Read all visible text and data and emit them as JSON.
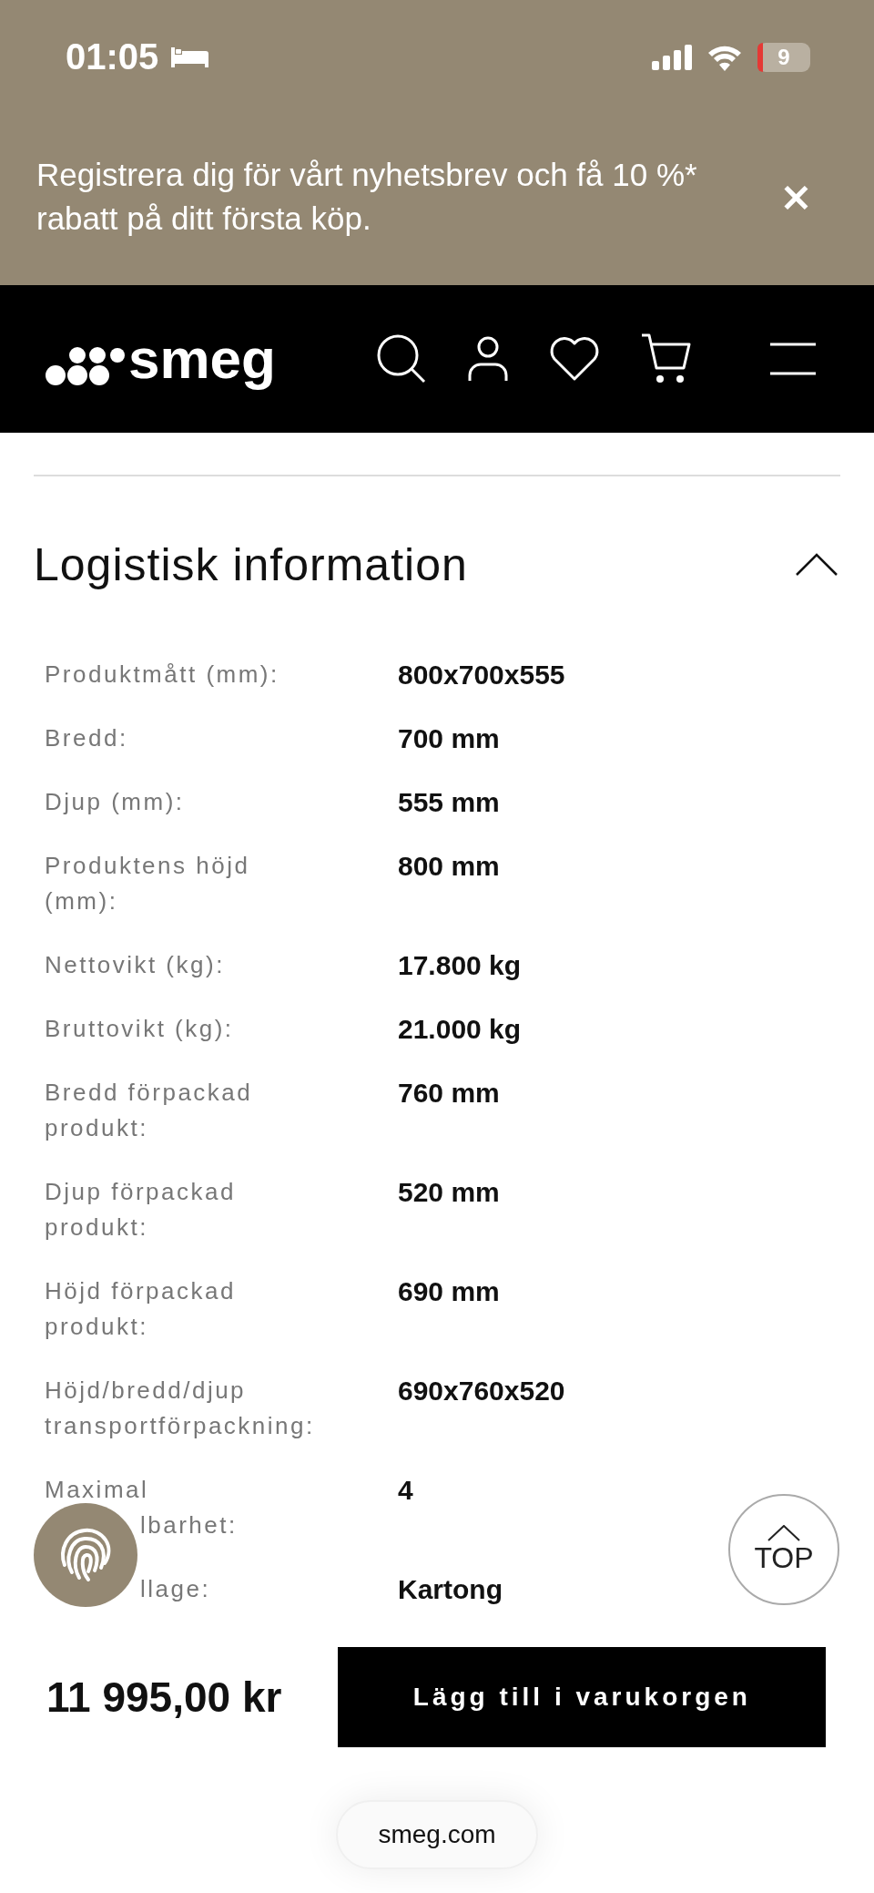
{
  "status_bar": {
    "time": "01:05",
    "battery": "9"
  },
  "banner": {
    "text": "Registrera dig för vårt nyhetsbrev och få 10 %* rabatt på ditt första köp.",
    "close": "×"
  },
  "nav": {
    "logo": "smeg"
  },
  "sections": [
    {
      "title": "Logistisk information",
      "expanded": true
    }
  ],
  "rows": [
    {
      "label": [
        "Produktmått (mm):"
      ],
      "value": "800x700x555",
      "overlapped": false
    },
    {
      "label": [
        "Bredd:"
      ],
      "value": "700 mm",
      "overlapped": false
    },
    {
      "label": [
        "Djup (mm):"
      ],
      "value": "555 mm",
      "overlapped": false
    },
    {
      "label": [
        "Produktens höjd",
        "(mm):"
      ],
      "value": "800 mm",
      "overlapped": false
    },
    {
      "label": [
        "Nettovikt (kg):"
      ],
      "value": "17.800 kg",
      "overlapped": false
    },
    {
      "label": [
        "Bruttovikt (kg):"
      ],
      "value": "21.000 kg",
      "overlapped": false
    },
    {
      "label": [
        "Bredd förpackad",
        "produkt:"
      ],
      "value": "760 mm",
      "overlapped": false
    },
    {
      "label": [
        "Djup förpackad",
        "produkt:"
      ],
      "value": "520 mm",
      "overlapped": false
    },
    {
      "label": [
        "Höjd förpackad",
        "produkt:"
      ],
      "value": "690 mm",
      "overlapped": false
    },
    {
      "label": [
        "Höjd/bredd/djup",
        "transportförpackning:"
      ],
      "value": "690x760x520",
      "overlapped": false
    },
    {
      "label": [
        "Maximal",
        "lbarhet:"
      ],
      "value": "4",
      "overlapped": true
    },
    {
      "label": [
        "llage:"
      ],
      "value": "Kartong",
      "overlapped": true
    }
  ],
  "top_button": "TOP",
  "price": "11 995,00 kr",
  "cart_button": "Lägg till i varukorgen",
  "url": "smeg.com"
}
